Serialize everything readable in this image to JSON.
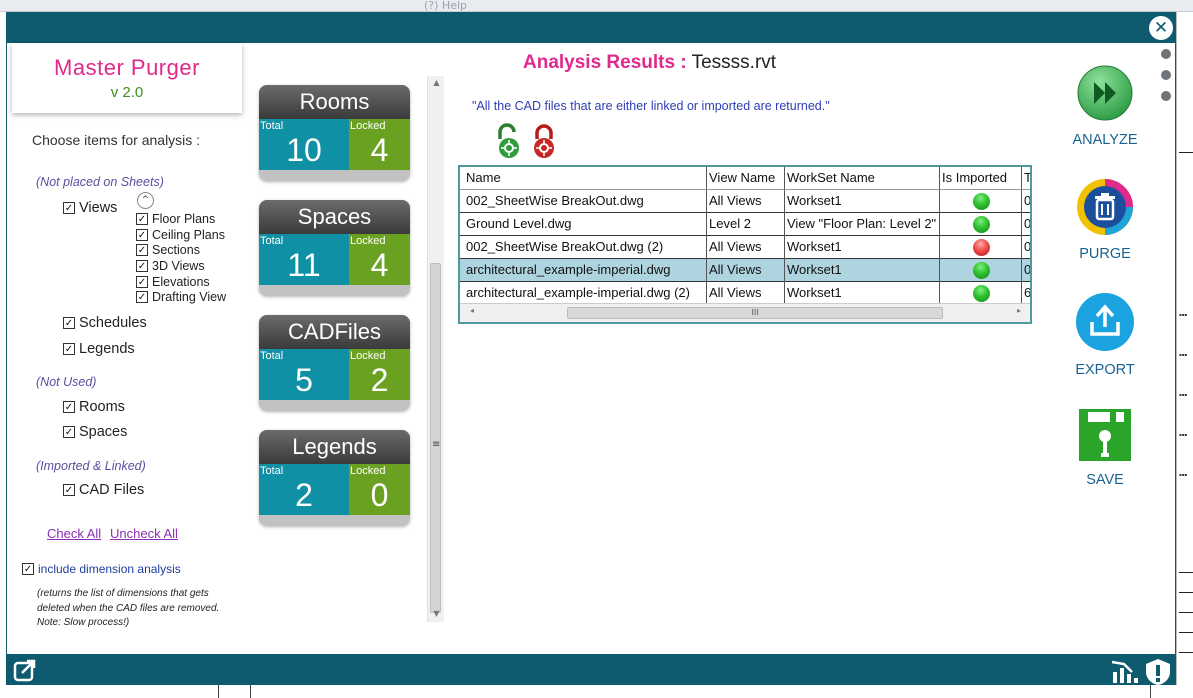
{
  "background": {
    "toolbar_items": [
      "(?) Help"
    ]
  },
  "window": {
    "close_label": "✕"
  },
  "brand": {
    "name": "Master Purger",
    "version": "v 2.0"
  },
  "options": {
    "heading": "Choose items for analysis :",
    "section_not_placed": "(Not placed on Sheets)",
    "views": "Views",
    "sub_views": [
      "Floor Plans",
      "Ceiling Plans",
      "Sections",
      "3D Views",
      "Elevations",
      "Drafting View"
    ],
    "schedules": "Schedules",
    "legends": "Legends",
    "section_not_used": "(Not Used)",
    "rooms": "Rooms",
    "spaces": "Spaces",
    "section_imported": "(Imported & Linked)",
    "cad_files": "CAD Files",
    "check_all": "Check All",
    "uncheck_all": "Uncheck All",
    "dimension_label": "include dimension analysis",
    "dimension_note": "(returns the list of dimensions that gets deleted when the CAD files are removed. Note: Slow process!)"
  },
  "cards": [
    {
      "title": "Rooms",
      "total_label": "Total",
      "total": "10",
      "locked_label": "Locked",
      "locked": "4"
    },
    {
      "title": "Spaces",
      "total_label": "Total",
      "total": "11",
      "locked_label": "Locked",
      "locked": "4"
    },
    {
      "title": "CADFiles",
      "total_label": "Total",
      "total": "5",
      "locked_label": "Locked",
      "locked": "2"
    },
    {
      "title": "Legends",
      "total_label": "Total",
      "total": "2",
      "locked_label": "Locked",
      "locked": "0"
    }
  ],
  "results": {
    "title_label": "Analysis Results :",
    "file_name": "Tessss.rvt",
    "note": "\"All the CAD files that are either linked or imported are returned.\"",
    "columns": [
      "Name",
      "View Name",
      "WorkSet Name",
      "Is Imported",
      "T"
    ],
    "rows": [
      {
        "name": "002_SheetWise BreakOut.dwg",
        "view": "All Views",
        "workset": "Workset1",
        "imported": "green",
        "extra": "0"
      },
      {
        "name": "Ground Level.dwg",
        "view": "Level 2",
        "workset": "View \"Floor Plan: Level 2\"",
        "imported": "green",
        "extra": "0"
      },
      {
        "name": "002_SheetWise BreakOut.dwg (2)",
        "view": "All Views",
        "workset": "Workset1",
        "imported": "red",
        "extra": "0"
      },
      {
        "name": "architectural_example-imperial.dwg",
        "view": "All Views",
        "workset": "Workset1",
        "imported": "green",
        "extra": "0"
      },
      {
        "name": "architectural_example-imperial.dwg (2)",
        "view": "All Views",
        "workset": "Workset1",
        "imported": "green",
        "extra": "6"
      }
    ],
    "selected_row": 3,
    "hscroll_grip": "III"
  },
  "actions": {
    "analyze": "ANALYZE",
    "purge": "PURGE",
    "export": "EXPORT",
    "save": "SAVE"
  },
  "colors": {
    "brand_pink": "#e0288d",
    "titlebar": "#0e5a6e",
    "card_total": "#0f90a4",
    "card_locked": "#6aa120",
    "action_text": "#1a6290",
    "selected_row": "#aed4e0"
  }
}
